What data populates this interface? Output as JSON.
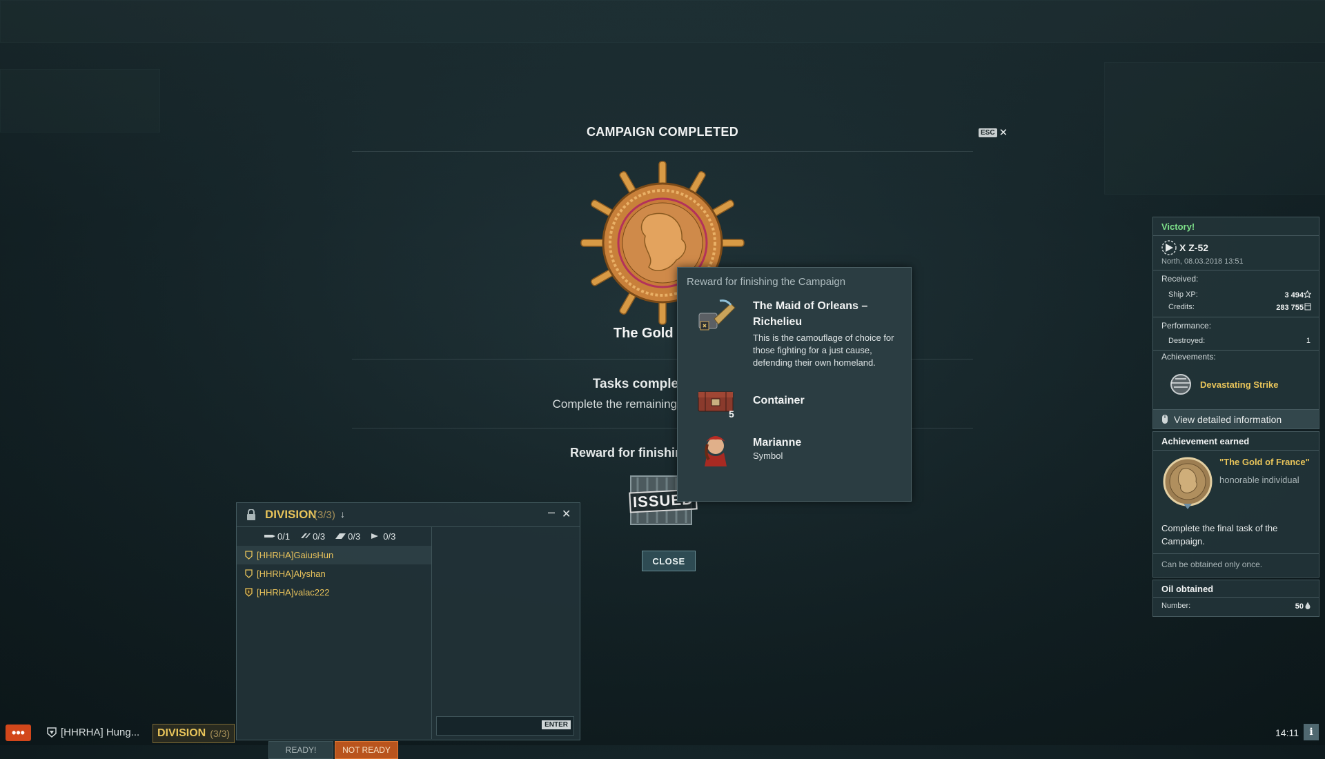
{
  "modal": {
    "title": "CAMPAIGN COMPLETED",
    "esc_label": "ESC",
    "close_glyph": "✕",
    "campaign_name": "The Gold of",
    "tasks_title": "Tasks complete",
    "tasks_desc": "Complete the remaining ta",
    "reward_title": "Reward for finishing",
    "issued_label": "ISSUED",
    "close_button": "CLOSE"
  },
  "tooltip": {
    "header": "Reward for finishing the Campaign",
    "items": [
      {
        "name": "The Maid of Orleans – Richelieu",
        "desc": "This is the camouflage of choice for those fighting for a just cause, defending their own homeland.",
        "icon": "camouflage-icon"
      },
      {
        "name": "Container",
        "count": "5",
        "icon": "container-icon"
      },
      {
        "name": "Marianne",
        "desc": "Symbol",
        "icon": "flag-symbol-icon"
      }
    ]
  },
  "division": {
    "title": "DIVISION",
    "count": "(3/3)",
    "arrow": "↓",
    "minimize": "–",
    "close": "✕",
    "stats": [
      {
        "icon": "destroyer-icon",
        "value": "0/1"
      },
      {
        "icon": "cruiser-icon",
        "value": "0/3"
      },
      {
        "icon": "battleship-icon",
        "value": "0/3"
      },
      {
        "icon": "flag-icon",
        "value": "0/3"
      }
    ],
    "members": [
      "[HHRHA]GaiusHun",
      "[HHRHA]Alyshan",
      "[HHRHA]valac222"
    ],
    "ready_label": "READY!",
    "not_ready_label": "NOT READY",
    "enter_label": "ENTER"
  },
  "battle": {
    "result": "Victory!",
    "ship": "X Z-52",
    "map_time": "North, 08.03.2018 13:51",
    "received_label": "Received:",
    "ship_xp_label": "Ship XP:",
    "ship_xp_value": "3 494",
    "credits_label": "Credits:",
    "credits_value": "283 755",
    "performance_label": "Performance:",
    "destroyed_label": "Destroyed:",
    "destroyed_value": "1",
    "achievements_label": "Achievements:",
    "achievement_name": "Devastating Strike",
    "view_details": "View detailed information"
  },
  "achievement": {
    "header": "Achievement earned",
    "name": "\"The Gold of France\"",
    "type": "honorable individual",
    "desc": "Complete the final task of the Campaign.",
    "note": "Can be obtained only once."
  },
  "oil": {
    "header": "Oil obtained",
    "label": "Number:",
    "value": "50"
  },
  "bottom": {
    "chat_glyph": "•••",
    "clan_tab": "[HHRHA] Hung...",
    "division_tab": "DIVISION",
    "division_tab_count": "(3/3)",
    "clock": "14:11",
    "info_glyph": "i"
  },
  "colors": {
    "accent_gold": "#e8c45a",
    "victory_green": "#7ee28a",
    "not_ready_orange": "#b9541d"
  }
}
